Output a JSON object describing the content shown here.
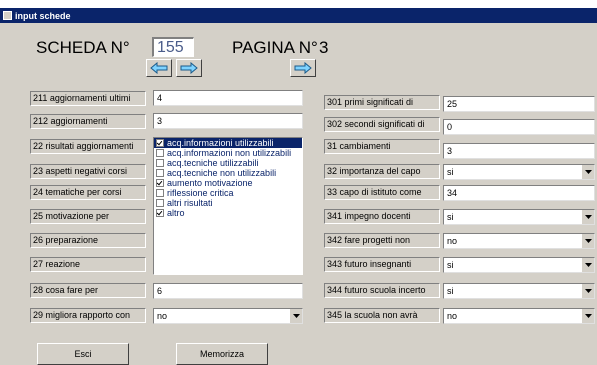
{
  "window": {
    "title": "input schede"
  },
  "header": {
    "scheda_label": "SCHEDA N°",
    "scheda_value": "155",
    "pagina_label": "PAGINA N°",
    "pagina_value": "3"
  },
  "left_fields": [
    {
      "label": "211 aggiornamenti ultimi",
      "value": "4"
    },
    {
      "label": "212 aggiornamenti",
      "value": "3"
    },
    {
      "label": "22 risultati aggiornamenti"
    },
    {
      "label": "23 aspetti negativi corsi"
    },
    {
      "label": "24 tematiche per corsi"
    },
    {
      "label": "25 motivazione per"
    },
    {
      "label": "26 preparazione"
    },
    {
      "label": "27 reazione"
    },
    {
      "label": "28 cosa fare per",
      "value": "6"
    },
    {
      "label": "29 migliora rapporto con",
      "value": "no"
    }
  ],
  "checklist": [
    {
      "text": "acq.informazioni utilizzabili",
      "checked": true,
      "selected": true
    },
    {
      "text": "acq.informazioni non utilizzabili",
      "checked": false
    },
    {
      "text": "acq.tecniche utilizzabili",
      "checked": false
    },
    {
      "text": "acq.tecniche non utilizzabili",
      "checked": false
    },
    {
      "text": "aumento motivazione",
      "checked": true
    },
    {
      "text": "riflessione critica",
      "checked": false
    },
    {
      "text": "altri risultati",
      "checked": false
    },
    {
      "text": "altro",
      "checked": true
    }
  ],
  "right_fields": [
    {
      "label": "301 primi significati di",
      "value": "25"
    },
    {
      "label": "302 secondi significati di",
      "value": "0"
    },
    {
      "label": "31 cambiamenti",
      "value": "3"
    },
    {
      "label": "32 importanza del capo",
      "value": "si"
    },
    {
      "label": "33 capo di istituto come",
      "value": "34"
    },
    {
      "label": "341 impegno docenti",
      "value": "si"
    },
    {
      "label": "342 fare progetti non",
      "value": "no"
    },
    {
      "label": "343 futuro insegnanti",
      "value": "si"
    },
    {
      "label": "344 futuro scuola incerto",
      "value": "si"
    },
    {
      "label": "345 la scuola non avrà",
      "value": "no"
    }
  ],
  "buttons": {
    "exit": "Esci",
    "save": "Memorizza"
  },
  "colors": {
    "titlebar": "#0a246a",
    "face": "#d4d0c8",
    "arrow_fill": "#7fd3ff"
  }
}
